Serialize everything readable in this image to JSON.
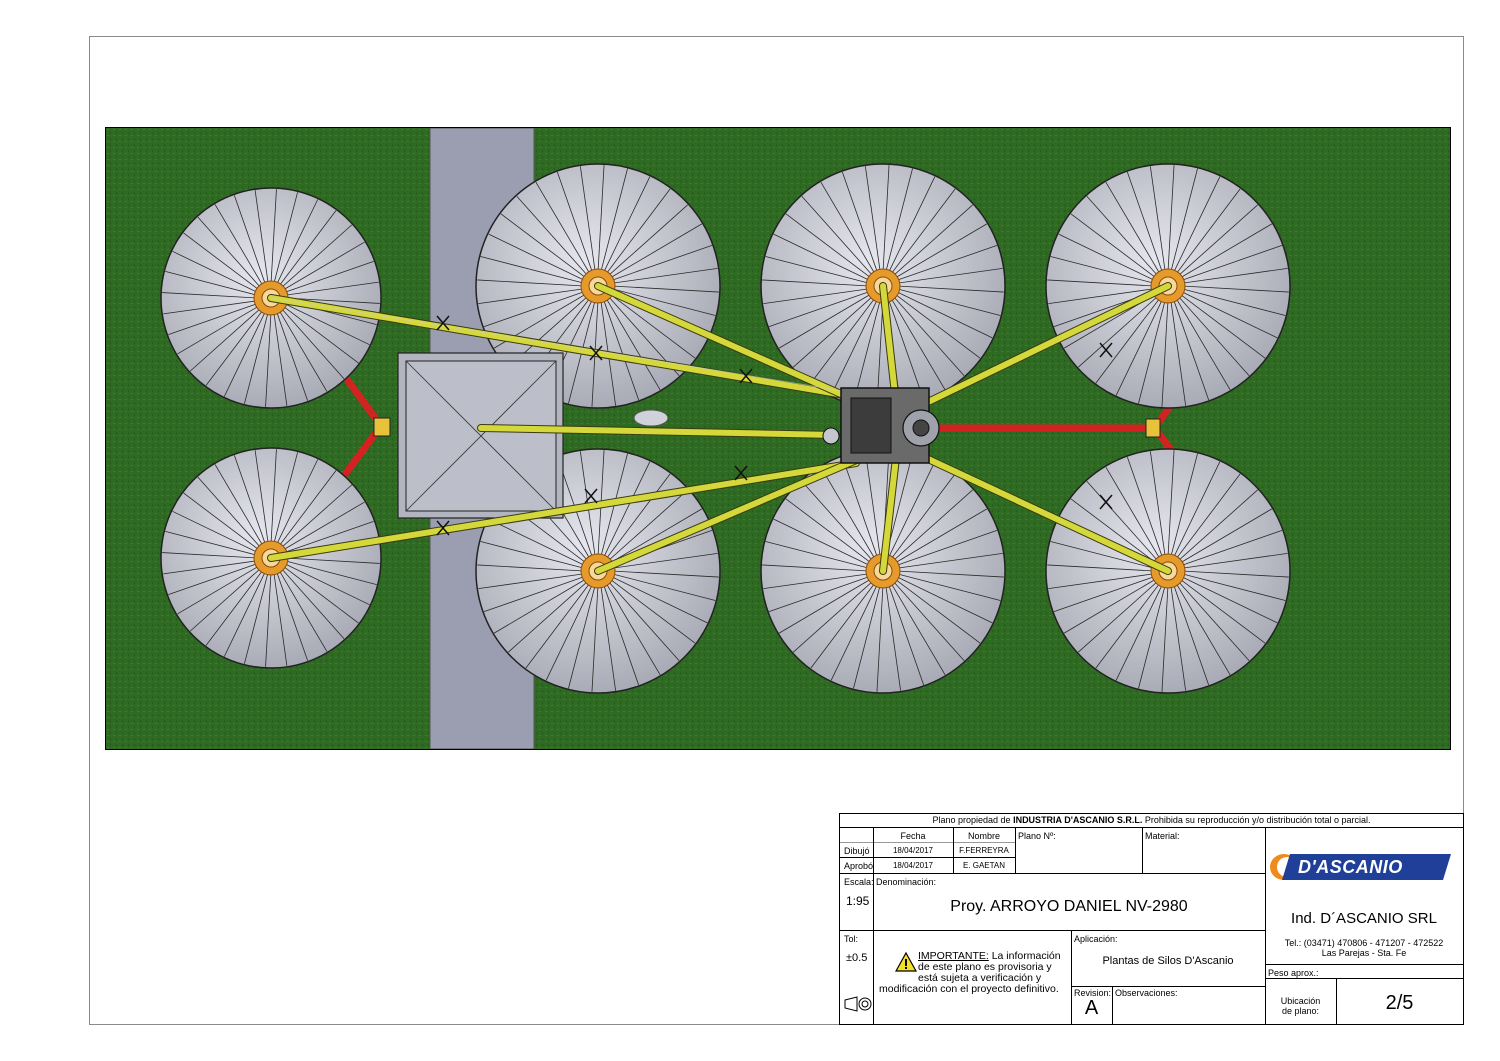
{
  "drawing": {
    "silos_right": [
      {
        "row": "top",
        "col": 1
      },
      {
        "row": "top",
        "col": 2
      },
      {
        "row": "top",
        "col": 3
      },
      {
        "row": "bottom",
        "col": 1
      },
      {
        "row": "bottom",
        "col": 2
      },
      {
        "row": "bottom",
        "col": 3
      }
    ],
    "silos_left": [
      {
        "row": "top"
      },
      {
        "row": "bottom"
      }
    ],
    "colors": {
      "grass": "#2f6a22",
      "road": "#9a9eb0",
      "silo_roof": "#c9cbd4",
      "silo_rib": "#2a2a2a",
      "conveyor": "#d4d83a",
      "support": "#d42222",
      "hopper": "#bcbfc9",
      "center_hub": "#e59a2c",
      "elevator": "#555555"
    }
  },
  "title_block": {
    "ownership_prefix": "Plano propiedad de ",
    "ownership_company": "INDUSTRIA D'ASCANIO S.R.L.",
    "ownership_suffix": " Prohibida su reproducción y/o distribución total o parcial.",
    "col_fecha": "Fecha",
    "col_nombre": "Nombre",
    "plano_no_label": "Plano Nº:",
    "material_label": "Material:",
    "dibujo_label": "Dibujó",
    "dibujo_fecha": "18/04/2017",
    "dibujo_nombre": "F.FERREYRA",
    "aprobo_label": "Aprobó",
    "aprobo_fecha": "18/04/2017",
    "aprobo_nombre": "E. GAETAN",
    "escala_label": "Escala:",
    "escala_value": "1:95",
    "denominacion_label": "Denominación:",
    "denominacion_value": "Proy. ARROYO DANIEL NV-2980",
    "tol_label": "Tol:",
    "tol_value": "±0.5",
    "aplicacion_label": "Aplicación:",
    "aplicacion_value": "Plantas de Silos D'Ascanio",
    "important_title": "IMPORTANTE:",
    "important_line1": " La información",
    "important_line2": "de este plano es provisoria y",
    "important_line3": "está sujeta a verificación y",
    "important_line4": "modificación con el proyecto definitivo.",
    "revision_label": "Revision:",
    "revision_value": "A",
    "observaciones_label": "Observaciones:",
    "logo_text": "D'ASCANIO",
    "company_name": "Ind. D´ASCANIO SRL",
    "company_phone": "Tel.: (03471) 470806 - 471207 - 472522",
    "company_city": "Las Parejas - Sta. Fe",
    "peso_label": "Peso aprox.:",
    "ubicacion_label_1": "Ubicación",
    "ubicacion_label_2": "de plano:",
    "ubicacion_value": "2/5"
  }
}
